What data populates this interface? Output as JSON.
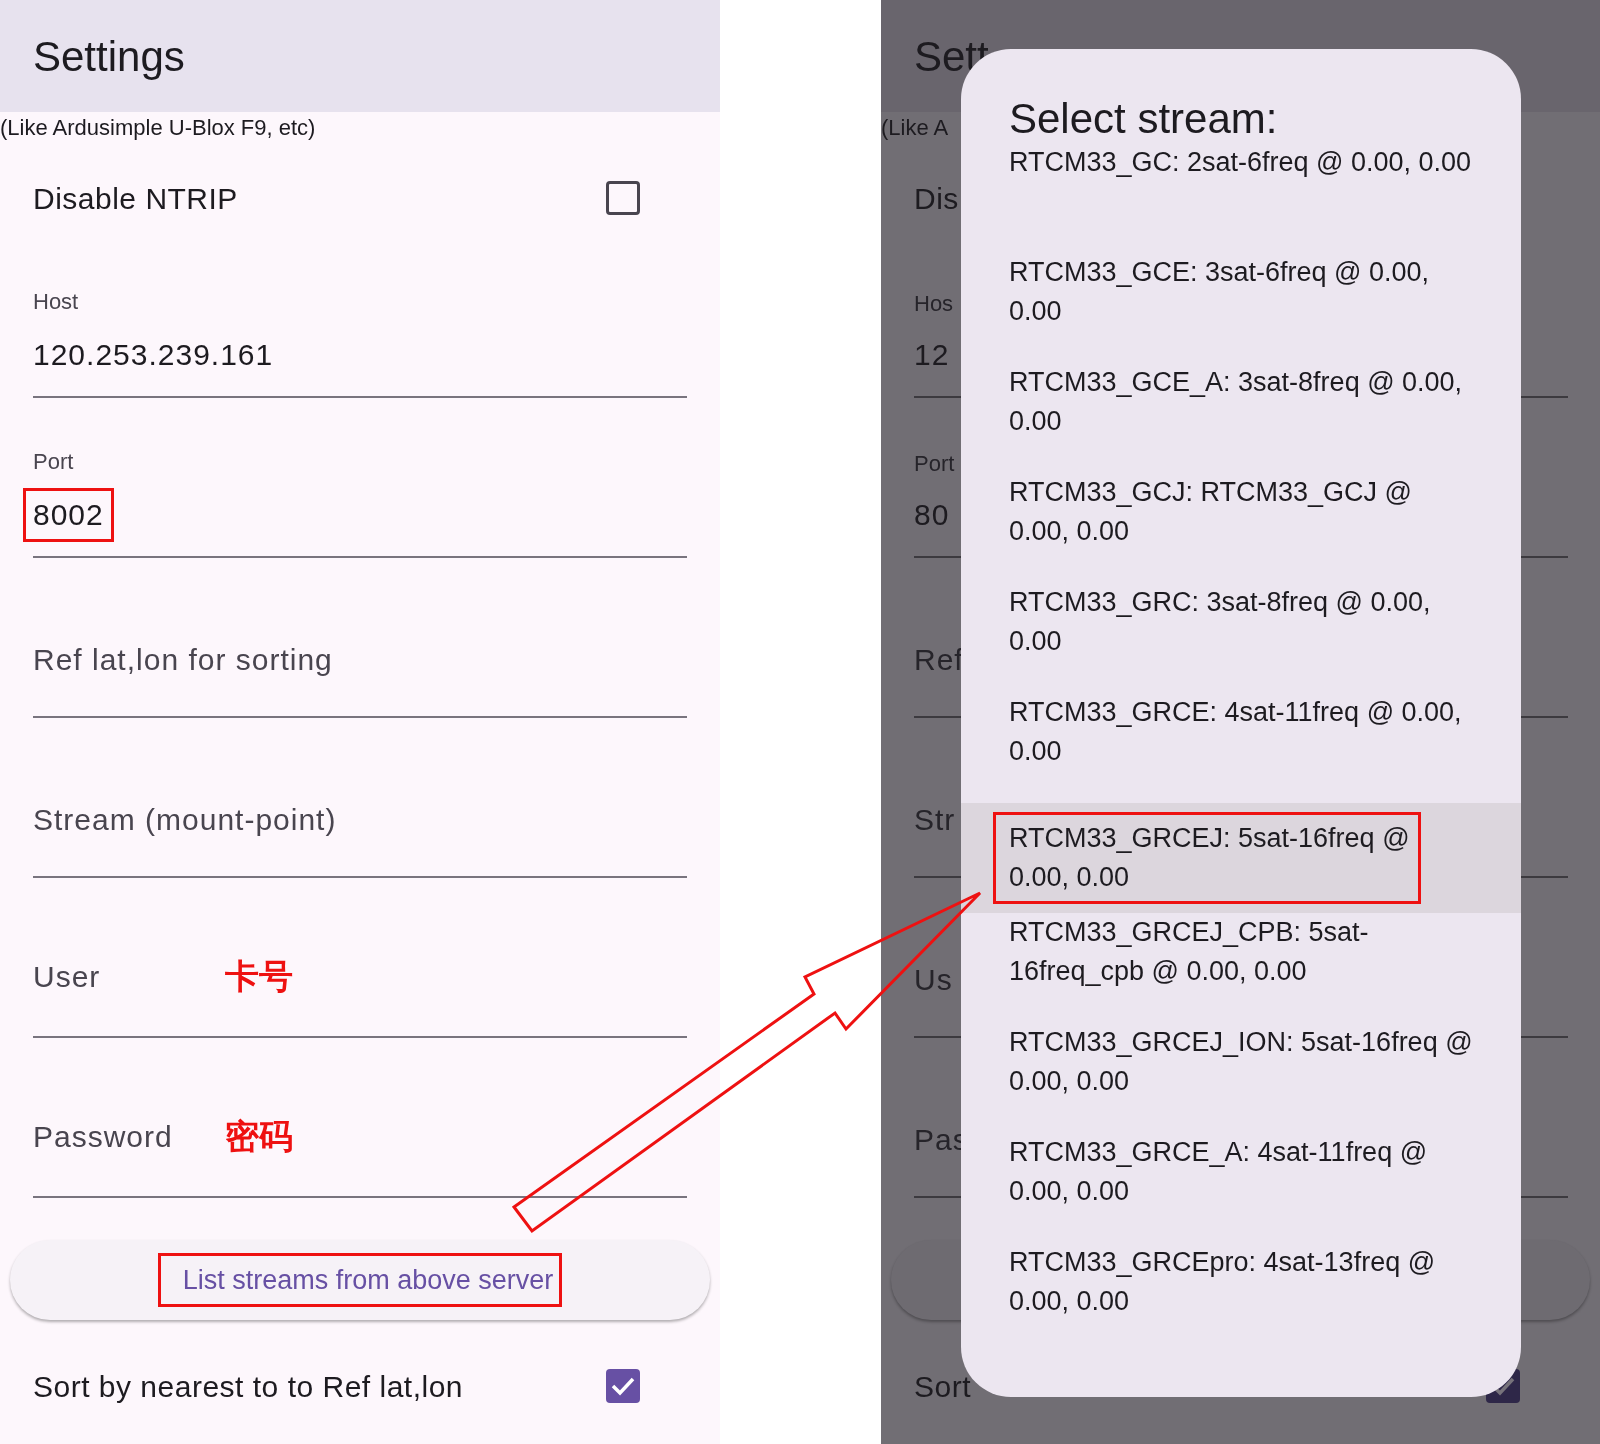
{
  "left_screen": {
    "app_bar": {
      "title": "Settings"
    },
    "note": "(Like Ardusimple U-Blox F9, etc)",
    "disable_ntrip": {
      "label": "Disable NTRIP",
      "checked": false
    },
    "fields": [
      {
        "label": "Host",
        "value": "120.253.239.161",
        "highlighted": false
      },
      {
        "label": "Port",
        "value": "8002",
        "highlighted": true
      },
      {
        "placeholder": "Ref lat,lon for sorting"
      },
      {
        "placeholder": "Stream (mount-point)"
      },
      {
        "placeholder": "User",
        "annotation": "卡号"
      },
      {
        "placeholder": "Password",
        "annotation": "密码"
      }
    ],
    "list_button": {
      "label": "List streams from above server",
      "highlighted": true
    },
    "sort_nearest": {
      "label": "Sort by nearest to to Ref lat,lon",
      "checked": true
    }
  },
  "right_screen": {
    "background": {
      "title": "Sett",
      "note": "(Like A",
      "disable_ntrip": "Dis",
      "fields": [
        {
          "label": "Hos",
          "value": "12"
        },
        {
          "label": "Port",
          "value": "80"
        },
        {
          "placeholder": "Ref"
        },
        {
          "placeholder": "Str"
        },
        {
          "placeholder": "Us"
        },
        {
          "placeholder": "Pas"
        }
      ],
      "sort_nearest": {
        "label": "Sort",
        "checked": true
      }
    },
    "dialog": {
      "title": "Select stream:",
      "items": [
        {
          "label": "RTCM33_GC: 2sat-6freq @ 0.00, 0.00",
          "selected": false,
          "highlighted": false
        },
        {
          "label": "RTCM33_GCE: 3sat-6freq @ 0.00, 0.00",
          "selected": false,
          "highlighted": false
        },
        {
          "label": "RTCM33_GCE_A: 3sat-8freq @ 0.00, 0.00",
          "selected": false,
          "highlighted": false
        },
        {
          "label": "RTCM33_GCJ: RTCM33_GCJ @ 0.00, 0.00",
          "selected": false,
          "highlighted": false
        },
        {
          "label": "RTCM33_GRC: 3sat-8freq @ 0.00, 0.00",
          "selected": false,
          "highlighted": false
        },
        {
          "label": "RTCM33_GRCE: 4sat-11freq @ 0.00, 0.00",
          "selected": false,
          "highlighted": false
        },
        {
          "label": "RTCM33_GRCEJ: 5sat-16freq @ 0.00, 0.00",
          "selected": true,
          "highlighted": true
        },
        {
          "label": "RTCM33_GRCEJ_CPB: 5sat-16freq_cpb @ 0.00, 0.00",
          "selected": false,
          "highlighted": false
        },
        {
          "label": "RTCM33_GRCEJ_ION: 5sat-16freq @ 0.00, 0.00",
          "selected": false,
          "highlighted": false
        },
        {
          "label": "RTCM33_GRCE_A: 4sat-11freq @ 0.00, 0.00",
          "selected": false,
          "highlighted": false
        },
        {
          "label": "RTCM33_GRCEpro: 4sat-13freq @ 0.00, 0.00",
          "selected": false,
          "highlighted": false
        }
      ]
    }
  }
}
